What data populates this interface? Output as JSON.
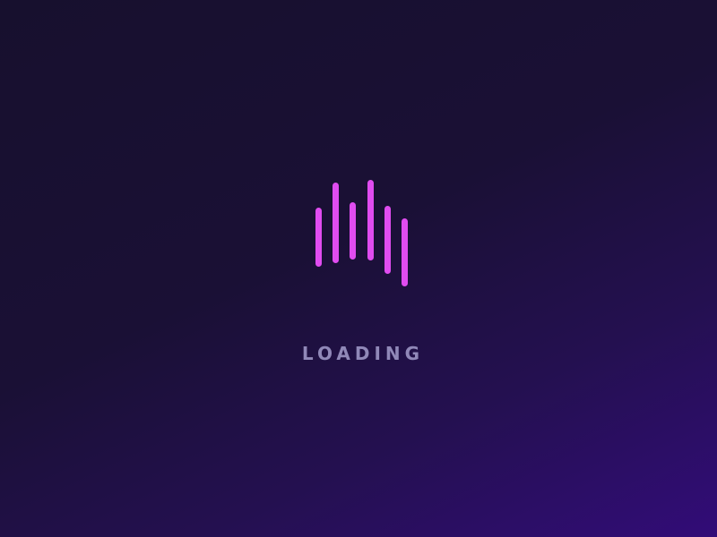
{
  "loading": {
    "label": "LOADING",
    "accent_color": "#e04cf0",
    "label_color": "#9088b8",
    "icon": "audio-wave-bars-icon"
  }
}
